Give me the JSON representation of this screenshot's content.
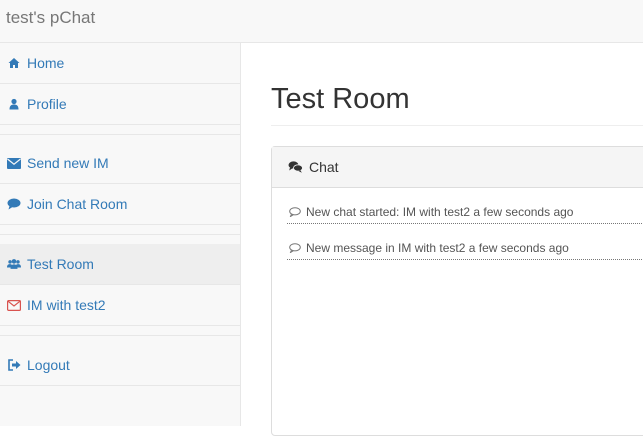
{
  "app": {
    "brand": "test's pChat"
  },
  "sidebar": {
    "items": [
      {
        "label": "Home",
        "icon": "home-icon"
      },
      {
        "label": "Profile",
        "icon": "user-icon"
      },
      {
        "label": "Send new IM",
        "icon": "envelope-icon"
      },
      {
        "label": "Join Chat Room",
        "icon": "comment-icon"
      },
      {
        "label": "Test Room",
        "icon": "users-icon",
        "active": true
      },
      {
        "label": "IM with test2",
        "icon": "envelope-outline-icon",
        "icon_color": "#d9534f"
      },
      {
        "label": "Logout",
        "icon": "logout-icon"
      }
    ]
  },
  "main": {
    "title": "Test Room",
    "panel": {
      "heading": "Chat",
      "messages": [
        {
          "text": "New chat started: IM with test2 a few seconds ago"
        },
        {
          "text": "New message in IM with test2 a few seconds ago"
        }
      ]
    }
  },
  "colors": {
    "link": "#337ab7",
    "alert": "#d9534f"
  }
}
